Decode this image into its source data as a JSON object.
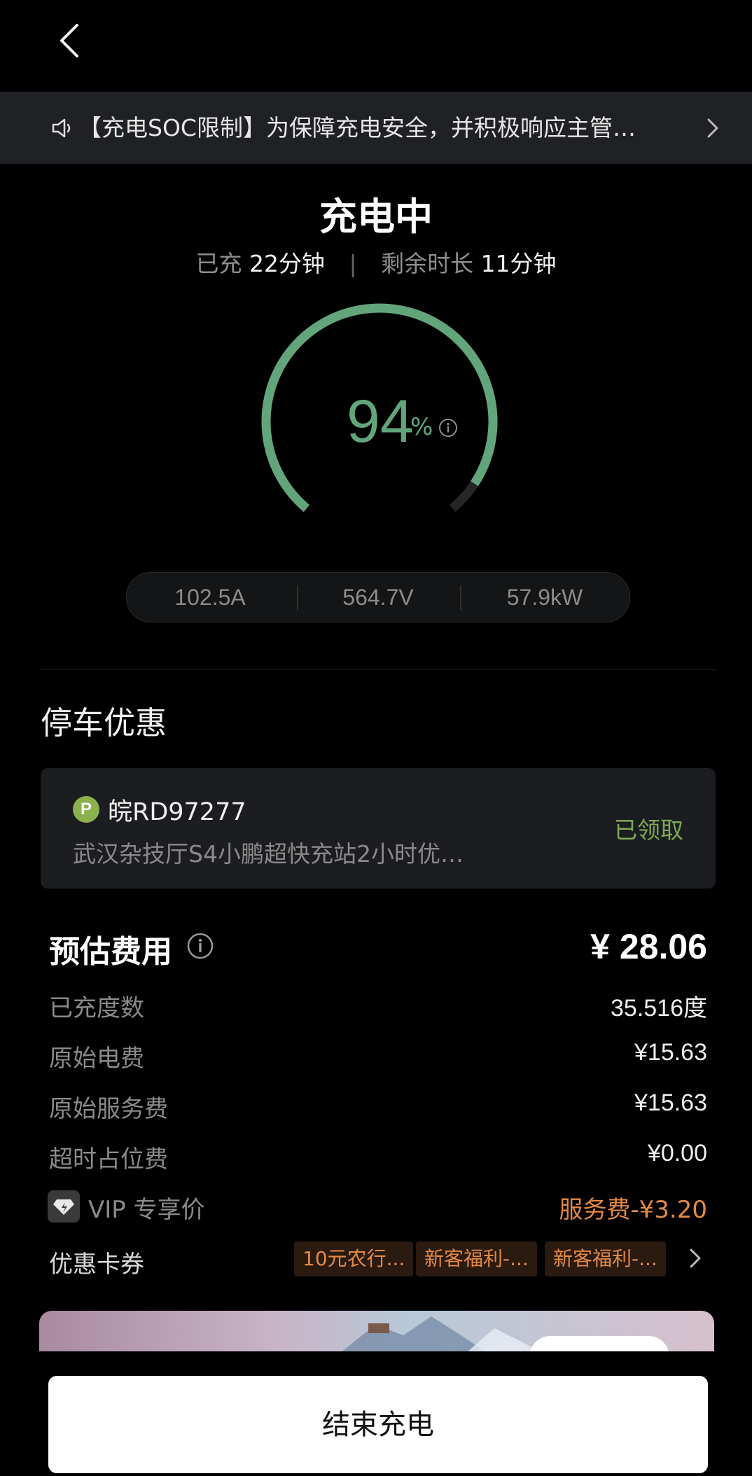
{
  "notice": {
    "text": "【充电SOC限制】为保障充电安全，并积极响应主管…"
  },
  "status": {
    "title": "充电中",
    "charged_label": "已充",
    "charged_value": "22分钟",
    "separator": "|",
    "remaining_label": "剩余时长",
    "remaining_value": "11分钟"
  },
  "gauge": {
    "percent": "94",
    "percent_value": 94,
    "unit": "%",
    "color": "#62a57b"
  },
  "metrics": {
    "current": "102.5A",
    "voltage": "564.7V",
    "power": "57.9kW"
  },
  "parking": {
    "title": "停车优惠",
    "badge": "P",
    "plate": "皖RD97277",
    "description": "武汉杂技厅S4小鹏超快充站2小时优…",
    "status": "已领取"
  },
  "fees": {
    "title": "预估费用",
    "total": "¥ 28.06",
    "rows": [
      {
        "label": "已充度数",
        "value": "35.516度"
      },
      {
        "label": "原始电费",
        "value": "¥15.63"
      },
      {
        "label": "原始服务费",
        "value": "¥15.63"
      },
      {
        "label": "超时占位费",
        "value": "¥0.00"
      }
    ],
    "vip_label": "VIP 专享价",
    "vip_value": "服务费-¥3.20",
    "coupon_label": "优惠卡券",
    "coupons": [
      "10元农行...",
      "新客福利-...",
      "新客福利-..."
    ]
  },
  "actions": {
    "end_label": "结束充电"
  },
  "icons": {
    "back": "chevron-left-icon",
    "notice": "speaker-icon",
    "notice_arrow": "chevron-right-icon",
    "info": "info-icon",
    "vip": "vip-diamond-icon",
    "coupon_arrow": "chevron-right-icon"
  }
}
